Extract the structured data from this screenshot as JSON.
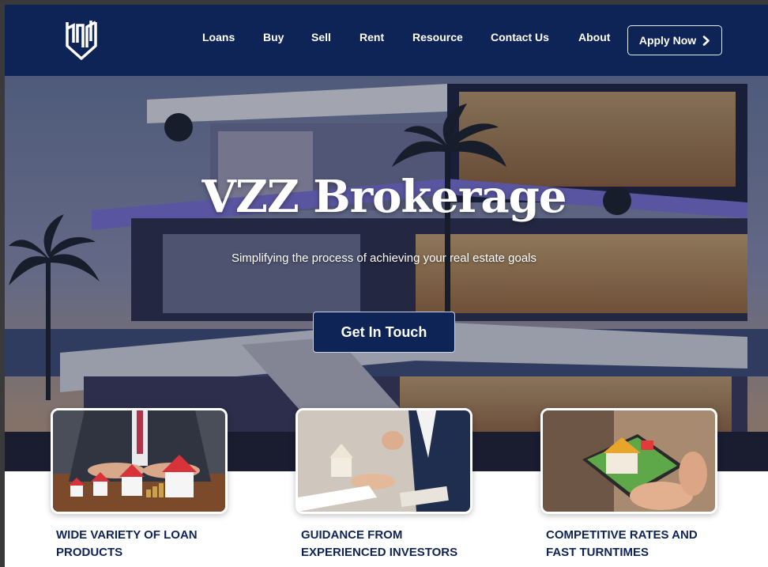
{
  "header": {
    "logo_icon": "vzz-shield-logo",
    "nav": [
      "Loans",
      "Buy",
      "Sell",
      "Rent",
      "Resource",
      "Contact Us",
      "About"
    ],
    "apply_label": "Apply Now",
    "apply_icon": "chevron-right-icon"
  },
  "hero": {
    "title": "VZZ Brokerage",
    "subtitle": "Simplifying the process of achieving your real estate goals",
    "cta_label": "Get In Touch"
  },
  "features": [
    {
      "title_line1": "WIDE VARIETY OF LOAN",
      "title_line2": "PRODUCTS"
    },
    {
      "title_line1": "GUIDANCE FROM",
      "title_line2": "EXPERIENCED INVESTORS"
    },
    {
      "title_line1": "COMPETITIVE RATES AND",
      "title_line2": "FAST TURNTIMES"
    }
  ],
  "colors": {
    "brand_navy": "#0f2456",
    "white": "#ffffff"
  }
}
